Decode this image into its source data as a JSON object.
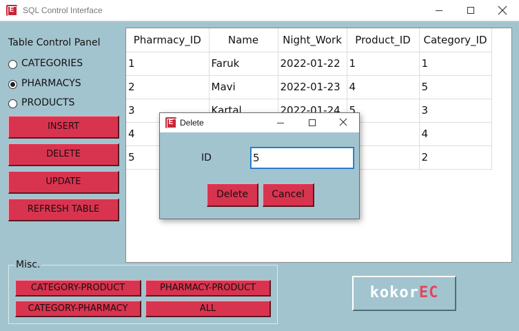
{
  "window": {
    "icon_letter": "E",
    "title": "SQL Control Interface",
    "controls": {
      "minimize_icon": "minimize-icon",
      "maximize_icon": "maximize-icon",
      "close_icon": "close-icon"
    }
  },
  "control_panel": {
    "title": "Table Control Panel",
    "radios": [
      {
        "label": "CATEGORIES",
        "checked": false
      },
      {
        "label": "PHARMACYS",
        "checked": true
      },
      {
        "label": "PRODUCTS",
        "checked": false
      }
    ],
    "buttons": {
      "insert": "INSERT",
      "delete": "DELETE",
      "update": "UPDATE",
      "refresh": "REFRESH TABLE"
    }
  },
  "table": {
    "columns": [
      "Pharmacy_ID",
      "Name",
      "Night_Work",
      "Product_ID",
      "Category_ID"
    ],
    "rows": [
      [
        "1",
        "Faruk",
        "2022-01-22",
        "1",
        "1"
      ],
      [
        "2",
        "Mavi",
        "2022-01-23",
        "4",
        "5"
      ],
      [
        "3",
        "Kartal",
        "2022-01-24",
        "5",
        "3"
      ],
      [
        "4",
        "",
        "",
        "",
        "4"
      ],
      [
        "5",
        "",
        "",
        "",
        "2"
      ]
    ]
  },
  "misc": {
    "label": "Misc.",
    "buttons": {
      "category_product": "CATEGORY-PRODUCT",
      "pharmacy_product": "PHARMACY-PRODUCT",
      "category_pharmacy": "CATEGORY-PHARMACY",
      "all": "ALL"
    }
  },
  "logo": {
    "part1": "kokor",
    "part2": "EC"
  },
  "dialog": {
    "icon_letter": "E",
    "title": "Delete",
    "field_label": "ID",
    "id_value": "5",
    "delete_label": "Delete",
    "cancel_label": "Cancel"
  },
  "colors": {
    "background": "#a2c4cf",
    "button": "#d9344f",
    "logo_accent": "#e8435c",
    "app_icon": "#c8273a"
  }
}
